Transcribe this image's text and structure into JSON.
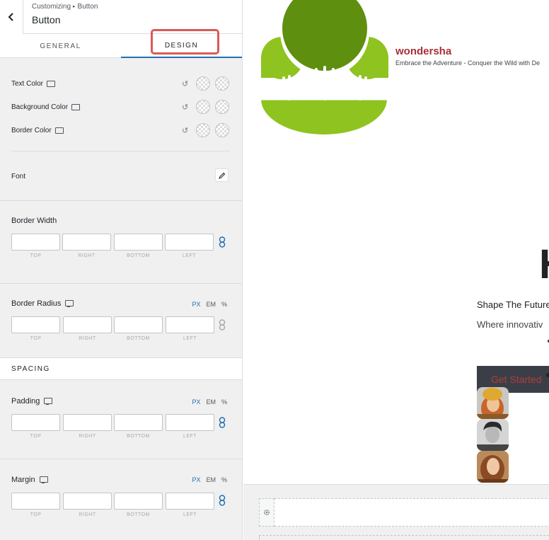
{
  "header": {
    "breadcrumb_root": "Customizing",
    "breadcrumb_current": "Button",
    "breadcrumb_separator": "▸",
    "title": "Button",
    "back_icon": "chevron-left-icon"
  },
  "tabs": [
    {
      "label": "GENERAL",
      "active": false
    },
    {
      "label": "DESIGN",
      "active": true
    }
  ],
  "colors": {
    "accent": "#2271b1",
    "highlight": "#dc5a55",
    "site_name": "#a72f3a",
    "logo_green_light": "#8fc31f",
    "logo_green_dark": "#5e8f0f"
  },
  "design": {
    "color_rows": [
      {
        "label": "Text Color"
      },
      {
        "label": "Background Color"
      },
      {
        "label": "Border Color"
      }
    ],
    "font_label": "Font",
    "border_width": {
      "label": "Border Width",
      "fields": [
        "TOP",
        "RIGHT",
        "BOTTOM",
        "LEFT"
      ]
    },
    "border_radius": {
      "label": "Border Radius",
      "units": [
        "PX",
        "EM",
        "%"
      ],
      "selected_unit": "PX",
      "fields": [
        "TOP",
        "RIGHT",
        "BOTTOM",
        "LEFT"
      ]
    },
    "spacing_heading": "SPACING",
    "padding": {
      "label": "Padding",
      "units": [
        "PX",
        "EM",
        "%"
      ],
      "selected_unit": "PX",
      "fields": [
        "TOP",
        "RIGHT",
        "BOTTOM",
        "LEFT"
      ]
    },
    "margin": {
      "label": "Margin",
      "units": [
        "PX",
        "EM",
        "%"
      ],
      "selected_unit": "PX",
      "fields": [
        "TOP",
        "RIGHT",
        "BOTTOM",
        "LEFT"
      ]
    }
  },
  "preview": {
    "site_name": "wondersha",
    "tagline": "Embrace the Adventure - Conquer the Wild with De",
    "hero_letter": "H",
    "shape_text": "Shape The Future",
    "where_text": "Where innovativ",
    "cta_label": "Get Started"
  }
}
